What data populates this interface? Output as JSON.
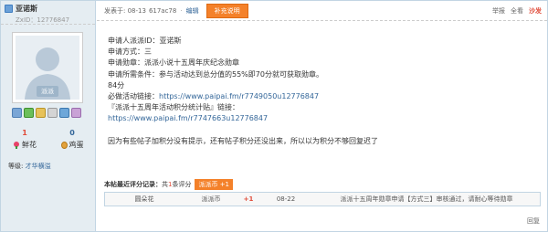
{
  "user": {
    "name": "亚诺斯",
    "zxid": "ZxID：12776847",
    "avatar_label": "派派",
    "stats": [
      {
        "value": "1",
        "label": "鲜花"
      },
      {
        "value": "0",
        "label": "鸡蛋"
      }
    ],
    "level_prefix": "等级: ",
    "level_value": "才华横溢"
  },
  "post_info": {
    "posted_at": "发表于: 08-13",
    "ip": "617ac78",
    "sep": "·",
    "edit": "编辑",
    "supplement": "补充说明",
    "actions": {
      "report": "举报",
      "view_all": "全看",
      "mark": "沙发"
    }
  },
  "content": {
    "lines": [
      "申请人派派ID：亚诺斯",
      "申请方式：三",
      "申请勋章：派派小说十五周年庆纪念勋章",
      "申请所需条件：参与活动达到总分值的55%即70分就可获取勋章。",
      "84分",
      "必做活动链接：https://www.paipai.fm/r7749050u12776847",
      "『派派十五周年活动积分统计贴』链接：",
      "https://www.paipai.fm/r7747663u12776847",
      "",
      "因为有些帖子加积分没有提示，还有帖子积分还没出来，所以以为积分不够回复迟了"
    ],
    "link1_prefix": "必做活动链接：",
    "link1": "https://www.paipai.fm/r7749050u12776847",
    "link2": "https://www.paipai.fm/r7747663u12776847"
  },
  "rating": {
    "title": "本帖最近评分记录：",
    "summary_pre": "共 ",
    "count": "1",
    "summary_post": " 条评分",
    "pill": "派派币 +1",
    "rows": [
      {
        "user": "圆朵花",
        "type": "派派币",
        "amount": "+1",
        "date": "08-22",
        "reason": "派派十五周年勋章申请【方式三】审核通过，请耐心等待勋章"
      }
    ]
  },
  "report_label": "回复"
}
